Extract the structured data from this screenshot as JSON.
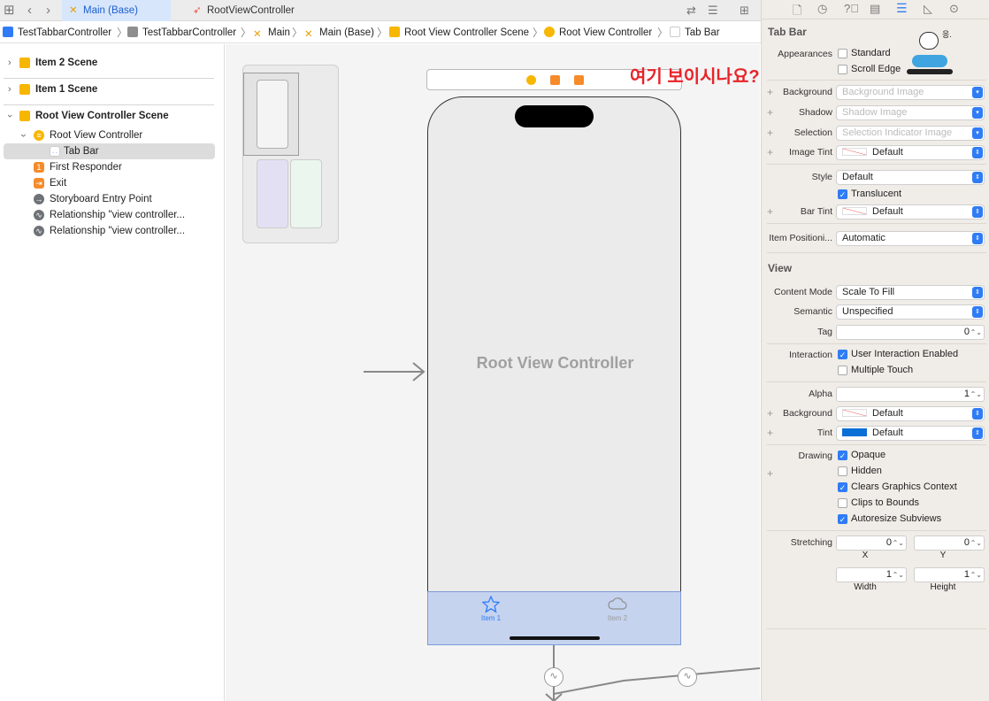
{
  "tabs": [
    {
      "label": "Main (Base)",
      "active": true
    },
    {
      "label": "RootViewController",
      "active": false
    }
  ],
  "breadcrumb": [
    "TestTabbarController",
    "TestTabbarController",
    "Main",
    "Main (Base)",
    "Root View Controller Scene",
    "Root View Controller",
    "Tab Bar"
  ],
  "outline": {
    "scenes": [
      {
        "label": "Item 2 Scene",
        "expanded": false
      },
      {
        "label": "Item 1 Scene",
        "expanded": false
      },
      {
        "label": "Root View Controller Scene",
        "expanded": true
      }
    ],
    "items": [
      {
        "label": "Root View Controller",
        "icon": "view-controller-icon"
      },
      {
        "label": "Tab Bar",
        "icon": "tab-bar-icon"
      },
      {
        "label": "First Responder",
        "icon": "first-responder-icon"
      },
      {
        "label": "Exit",
        "icon": "exit-icon"
      },
      {
        "label": "Storyboard Entry Point",
        "icon": "entry-point-icon"
      },
      {
        "label": "Relationship \"view controller...",
        "icon": "relationship-icon"
      },
      {
        "label": "Relationship \"view controller...",
        "icon": "relationship-icon"
      }
    ]
  },
  "canvas": {
    "controller_title": "Root View Controller",
    "tab_items": [
      {
        "label": "Item 1",
        "icon": "star-icon",
        "selected": true
      },
      {
        "label": "Item 2",
        "icon": "cloud-icon",
        "selected": false
      }
    ],
    "annotation": "여기 보이시나요?"
  },
  "inspector": {
    "tabbar_section": "Tab Bar",
    "appearances_label": "Appearances",
    "standard": "Standard",
    "scroll_edge": "Scroll Edge",
    "background_label": "Background",
    "background_value": "Background Image",
    "shadow_label": "Shadow",
    "shadow_value": "Shadow Image",
    "selection_label": "Selection",
    "selection_value": "Selection Indicator Image",
    "image_tint_label": "Image Tint",
    "image_tint_value": "Default",
    "style_label": "Style",
    "style_value": "Default",
    "translucent": "Translucent",
    "bar_tint_label": "Bar Tint",
    "bar_tint_value": "Default",
    "item_pos_label": "Item Positioni...",
    "item_pos_value": "Automatic",
    "view_section": "View",
    "content_mode_label": "Content Mode",
    "content_mode_value": "Scale To Fill",
    "semantic_label": "Semantic",
    "semantic_value": "Unspecified",
    "tag_label": "Tag",
    "tag_value": "0",
    "interaction_label": "Interaction",
    "user_interaction": "User Interaction Enabled",
    "multiple_touch": "Multiple Touch",
    "alpha_label": "Alpha",
    "alpha_value": "1",
    "bg_label": "Background",
    "bg_value": "Default",
    "tint_label": "Tint",
    "tint_value": "Default",
    "drawing_label": "Drawing",
    "opaque": "Opaque",
    "hidden": "Hidden",
    "clears": "Clears Graphics Context",
    "clips": "Clips to Bounds",
    "autoresize": "Autoresize Subviews",
    "stretching_label": "Stretching",
    "stretch_x": "0",
    "stretch_y": "0",
    "x_label": "X",
    "y_label": "Y",
    "stretch_w": "1",
    "stretch_h": "1",
    "width_label": "Width",
    "height_label": "Height",
    "sticker_text": "응."
  },
  "colors": {
    "accent": "#2f7cf6",
    "tint_blue": "#0a6fd6",
    "annotation": "#e8232a"
  }
}
